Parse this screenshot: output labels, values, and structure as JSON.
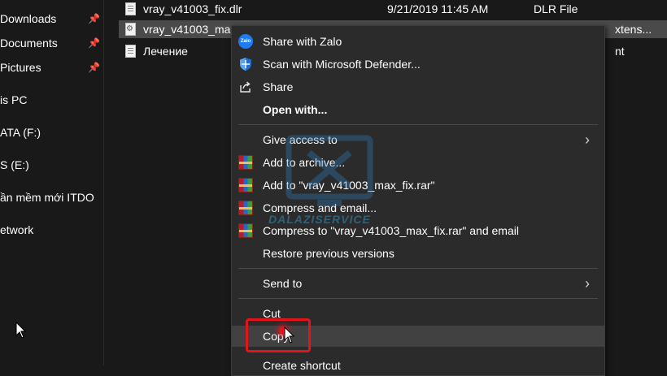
{
  "sidebar": {
    "items": [
      {
        "label": "Downloads",
        "pinned": true,
        "icon": "pin-icon"
      },
      {
        "label": "Documents",
        "pinned": true,
        "icon": "pin-icon"
      },
      {
        "label": "Pictures",
        "pinned": true,
        "icon": "pin-icon"
      },
      {
        "label": "is PC"
      },
      {
        "label": "ATA (F:)"
      },
      {
        "label": "S (E:)"
      },
      {
        "label": "ần mềm mới ITDO"
      },
      {
        "label": "etwork"
      }
    ]
  },
  "files": [
    {
      "name": "vray_v41003_fix.dlr",
      "date": "9/21/2019 11:45 AM",
      "type": "DLR File",
      "icon": "document-icon"
    },
    {
      "name": "vray_v41003_ma",
      "date": "",
      "type": "xtens...",
      "icon": "config-file-icon",
      "selected": true
    },
    {
      "name": "Лечение",
      "date": "",
      "type": "nt",
      "icon": "document-icon"
    }
  ],
  "menu": {
    "items": [
      {
        "label": "Share with Zalo",
        "icon": "zalo-icon"
      },
      {
        "label": "Scan with Microsoft Defender...",
        "icon": "defender-shield-icon"
      },
      {
        "label": "Share",
        "icon": "share-icon"
      },
      {
        "label": "Open with...",
        "bold": true
      },
      {
        "label": "Give access to",
        "submenu": true
      },
      {
        "label": "Add to archive...",
        "icon": "winrar-icon"
      },
      {
        "label": "Add to \"vray_v41003_max_fix.rar\"",
        "icon": "winrar-icon"
      },
      {
        "label": "Compress and email...",
        "icon": "winrar-icon"
      },
      {
        "label": "Compress to \"vray_v41003_max_fix.rar\" and email",
        "icon": "winrar-icon"
      },
      {
        "label": "Restore previous versions"
      },
      {
        "label": "Send to",
        "submenu": true
      },
      {
        "label": "Cut"
      },
      {
        "label": "Copy",
        "highlighted": true
      },
      {
        "label": "Create shortcut"
      }
    ],
    "submenu_glyph": "›"
  },
  "watermark": {
    "text": "DALAZISERVICE"
  },
  "colors": {
    "background": "#191919",
    "menu": "#2b2b2b",
    "highlight_box": "#e3141e",
    "zalo": "#1e7bf2"
  }
}
